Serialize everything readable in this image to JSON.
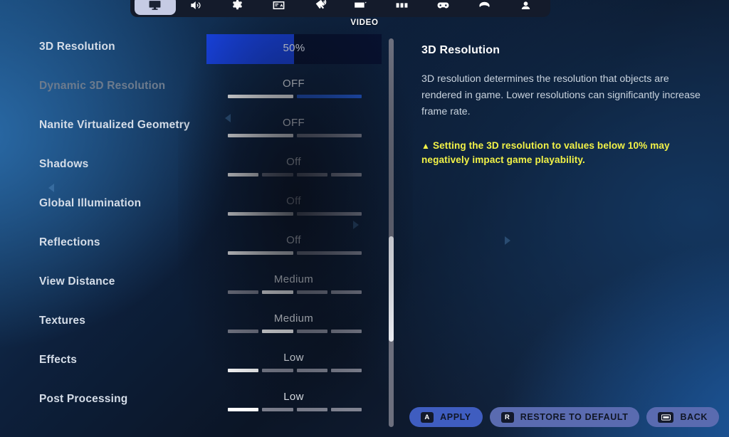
{
  "tabs": [
    {
      "icon": "monitor-icon",
      "label": "VIDEO",
      "active": true
    },
    {
      "icon": "audio-icon",
      "label": "AUDIO",
      "active": false
    },
    {
      "icon": "game-settings-icon",
      "label": "GAME",
      "active": false
    },
    {
      "icon": "subtitles-icon",
      "label": "SUBTITLES",
      "active": false
    },
    {
      "icon": "accessibility-icon",
      "label": "ACCESSIBILITY",
      "active": false
    },
    {
      "icon": "keyboard-icon",
      "label": "KEYBOARD",
      "active": false
    },
    {
      "icon": "hud-layout-icon",
      "label": "HUD LAYOUT",
      "active": false
    },
    {
      "icon": "controller-icon",
      "label": "CONTROLLER",
      "active": false
    },
    {
      "icon": "wheel-icon",
      "label": "WHEEL",
      "active": false
    },
    {
      "icon": "account-icon",
      "label": "ACCOUNT",
      "active": false
    }
  ],
  "active_tab_label": "VIDEO",
  "settings": [
    {
      "label": "3D Resolution",
      "value": "50%",
      "type": "slider",
      "fill_percent": 50,
      "dim": false,
      "segments": 0,
      "active_index": -1
    },
    {
      "label": "Dynamic 3D Resolution",
      "value": "OFF",
      "type": "segments",
      "dim": true,
      "segments": 2,
      "active_index": 0,
      "highlight_color": "blue"
    },
    {
      "label": "Nanite Virtualized Geometry",
      "value": "OFF",
      "type": "segments",
      "dim": false,
      "segments": 2,
      "active_index": 0
    },
    {
      "label": "Shadows",
      "value": "Off",
      "type": "segments",
      "dim": false,
      "segments": 4,
      "active_index": 0
    },
    {
      "label": "Global Illumination",
      "value": "Off",
      "type": "segments",
      "dim": false,
      "segments": 2,
      "active_index": 0
    },
    {
      "label": "Reflections",
      "value": "Off",
      "type": "segments",
      "dim": false,
      "segments": 2,
      "active_index": 0
    },
    {
      "label": "View Distance",
      "value": "Medium",
      "type": "segments",
      "dim": false,
      "segments": 4,
      "active_index": 1
    },
    {
      "label": "Textures",
      "value": "Medium",
      "type": "segments",
      "dim": false,
      "segments": 4,
      "active_index": 1
    },
    {
      "label": "Effects",
      "value": "Low",
      "type": "segments",
      "dim": false,
      "segments": 4,
      "active_index": 0
    },
    {
      "label": "Post Processing",
      "value": "Low",
      "type": "segments",
      "dim": false,
      "segments": 4,
      "active_index": 0
    }
  ],
  "detail": {
    "title": "3D Resolution",
    "body": "3D resolution determines the resolution that objects are rendered in game. Lower resolutions can significantly increase frame rate.",
    "warning_icon": "warning-triangle-icon",
    "warning": "Setting the 3D resolution to values below 10% may negatively impact game playability."
  },
  "footer": {
    "buttons": [
      {
        "key": "A",
        "label": "APPLY",
        "name": "apply-button",
        "style": "accent"
      },
      {
        "key": "R",
        "label": "RESTORE TO DEFAULT",
        "name": "restore-to-default-button",
        "style": "normal"
      },
      {
        "key": "",
        "label": "BACK",
        "name": "back-button",
        "style": "normal",
        "key_icon": "back-key-icon"
      }
    ]
  },
  "colors": {
    "accent_blue": "#1740d8",
    "warning_yellow": "#f2f247",
    "segment_on": "#ffffff",
    "segment_off": "#808391"
  }
}
